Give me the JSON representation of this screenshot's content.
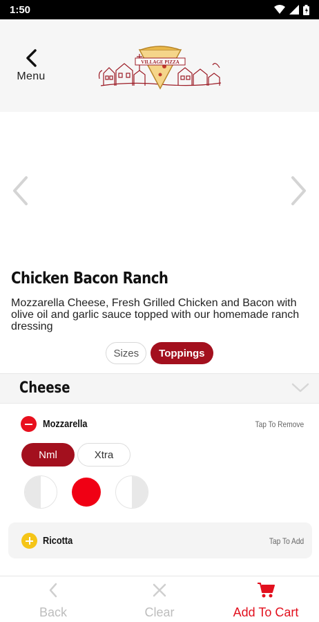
{
  "status_bar": {
    "time": "1:50"
  },
  "header": {
    "back_label": "Menu",
    "logo_text": "VILLAGE PIZZA"
  },
  "item": {
    "title": "Chicken Bacon Ranch",
    "description": "Mozzarella Cheese, Fresh Grilled Chicken and Bacon with olive oil and garlic sauce topped with our homemade ranch dressing"
  },
  "tabs": [
    {
      "label": "Sizes",
      "active": false
    },
    {
      "label": "Toppings",
      "active": true
    }
  ],
  "section": {
    "title": "Cheese"
  },
  "toppings": [
    {
      "name": "Mozzarella",
      "hint": "Tap To Remove",
      "selected": true,
      "amounts": [
        "Nml",
        "Xtra"
      ],
      "selected_amount": "Nml",
      "portion_selected": "whole"
    },
    {
      "name": "Ricotta",
      "hint": "Tap To Add",
      "selected": false
    }
  ],
  "bottom_bar": {
    "back": "Back",
    "clear": "Clear",
    "add_to_cart": "Add To Cart"
  },
  "colors": {
    "brand": "#a3101e",
    "accent_red": "#e8101e",
    "add_yellow": "#f5c518"
  }
}
